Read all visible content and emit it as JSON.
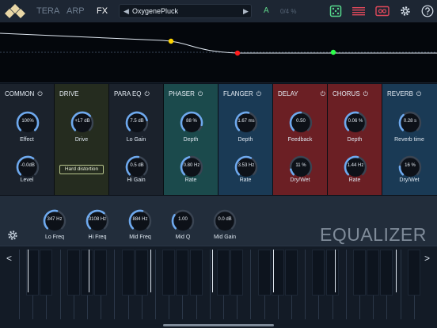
{
  "header": {
    "tabs": [
      {
        "label": "TERA",
        "active": false
      },
      {
        "label": "ARP",
        "active": false
      },
      {
        "label": "FX",
        "active": true
      }
    ],
    "preset_name": "OxygenePluck",
    "prev_icon": "◀",
    "next_icon": "▶",
    "ab_label": "A",
    "cpu_label": "0/4 %",
    "icons": [
      "dice-icon",
      "bars-icon",
      "record-icon",
      "gear-icon",
      "help-icon"
    ],
    "colors": {
      "accent": "#56d88c",
      "record": "#e0495b",
      "text": "#ffffff",
      "muted": "#6f7e90"
    }
  },
  "curve": {
    "points": [
      {
        "color": "#ffd400"
      },
      {
        "color": "#ff1e1e"
      },
      {
        "color": "#2cff4a"
      }
    ]
  },
  "fx": {
    "common": {
      "title": "COMMON",
      "knobs": [
        {
          "value": "100%",
          "label": "Effect",
          "level": 1.0
        },
        {
          "value": "-0.0dB",
          "label": "Level",
          "level": 0.62
        }
      ]
    },
    "drive": {
      "title": "DRIVE",
      "knobs": [
        {
          "value": "+17 dB",
          "label": "Drive",
          "level": 0.68
        }
      ],
      "mode_button": "Hard distortion"
    },
    "paraeq": {
      "title": "PARA EQ",
      "knobs": [
        {
          "value": "7.5 dB",
          "label": "Lo Gain",
          "level": 0.78
        },
        {
          "value": "0.5 dB",
          "label": "Hi Gain",
          "level": 0.53
        }
      ]
    },
    "phaser": {
      "title": "PHASER",
      "knobs": [
        {
          "value": "88 %",
          "label": "Depth",
          "level": 0.88
        },
        {
          "value": "0.80 Hz",
          "label": "Rate",
          "level": 0.45
        }
      ]
    },
    "flanger": {
      "title": "FLANGER",
      "knobs": [
        {
          "value": "1.67 ms",
          "label": "Depth",
          "level": 0.55
        },
        {
          "value": "3.53 Hz",
          "label": "Rate",
          "level": 0.6
        }
      ]
    },
    "delay": {
      "title": "DELAY",
      "knobs": [
        {
          "value": "0.50",
          "label": "Feedback",
          "level": 0.5
        },
        {
          "value": "11  %",
          "label": "Dry/Wet",
          "level": 0.12
        }
      ]
    },
    "chorus": {
      "title": "CHORUS",
      "knobs": [
        {
          "value": "0.06  %",
          "label": "Depth",
          "level": 0.55
        },
        {
          "value": "1.44 Hz",
          "label": "Rate",
          "level": 0.55
        }
      ]
    },
    "reverb": {
      "title": "REVERB",
      "knobs": [
        {
          "value": "0.28 s",
          "label": "Reverb time",
          "level": 0.35
        },
        {
          "value": "16  %",
          "label": "Dry/Wet",
          "level": 0.18
        }
      ]
    },
    "colors": {
      "common": "#1b222c",
      "drive": "#252c1f",
      "paraeq": "#1b222c",
      "phaser": "#1b4a4c",
      "flanger": "#1a3a55",
      "delay": "#6b1f24",
      "chorus": "#6b1f24",
      "reverb": "#1a3a55",
      "arc": "#6ea9ee"
    }
  },
  "equalizer": {
    "title": "EQUALIZER",
    "knobs": [
      {
        "value": "347 Hz",
        "label": "Lo Freq",
        "level": 0.55
      },
      {
        "value": "3108 Hz",
        "label": "Hi Freq",
        "level": 0.65
      },
      {
        "value": "884 Hz",
        "label": "Mid Freq",
        "level": 0.55
      },
      {
        "value": "1.00",
        "label": "Mid Q",
        "level": 0.3
      },
      {
        "value": "0.0 dB",
        "label": "Mid Gain",
        "level": 0.0
      }
    ]
  },
  "keyboard": {
    "left_arrow": "<",
    "right_arrow": ">"
  }
}
